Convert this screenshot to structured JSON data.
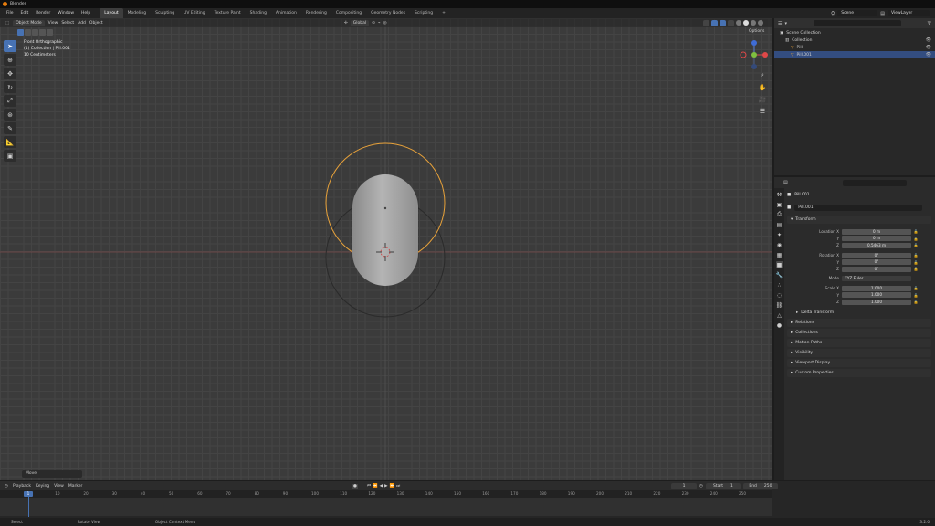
{
  "app": {
    "title": "Blender"
  },
  "menus": [
    "File",
    "Edit",
    "Render",
    "Window",
    "Help"
  ],
  "workspaces": [
    {
      "label": "Layout",
      "active": true
    },
    {
      "label": "Modeling",
      "active": false
    },
    {
      "label": "Sculpting",
      "active": false
    },
    {
      "label": "UV Editing",
      "active": false
    },
    {
      "label": "Texture Paint",
      "active": false
    },
    {
      "label": "Shading",
      "active": false
    },
    {
      "label": "Animation",
      "active": false
    },
    {
      "label": "Rendering",
      "active": false
    },
    {
      "label": "Compositing",
      "active": false
    },
    {
      "label": "Geometry Nodes",
      "active": false
    },
    {
      "label": "Scripting",
      "active": false
    },
    {
      "label": "+",
      "active": false
    }
  ],
  "scene": {
    "name": "Scene",
    "view_layer": "ViewLayer"
  },
  "viewport": {
    "mode": "Object Mode",
    "menu": [
      "View",
      "Select",
      "Add",
      "Object"
    ],
    "transform_orientation": "Global",
    "options_label": "Options",
    "overlay_lines": [
      "Front Orthographic",
      "(1) Collection | Pill.001",
      "10 Centimeters"
    ],
    "redo_label": "Move"
  },
  "toolbar": [
    "select",
    "cursor",
    "move",
    "rotate",
    "scale",
    "transform",
    "annotate",
    "measure",
    "add-cube"
  ],
  "outliner": {
    "rows": [
      {
        "label": "Scene Collection",
        "indent": 0,
        "selected": false
      },
      {
        "label": "Collection",
        "indent": 1,
        "selected": false
      },
      {
        "label": "Pill",
        "indent": 2,
        "selected": false
      },
      {
        "label": "Pill.001",
        "indent": 2,
        "selected": true
      }
    ]
  },
  "properties": {
    "object_name": "Pill.001",
    "object_field": "Pill.001",
    "transform_label": "Transform",
    "location_label": "Location X",
    "rotation_label": "Rotation X",
    "scale_label": "Scale X",
    "mode_label": "Mode",
    "mode_value": "XYZ Euler",
    "axis_y": "Y",
    "axis_z": "Z",
    "location": [
      "0 m",
      "0 m",
      "0.5463 m"
    ],
    "rotation": [
      "0°",
      "0°",
      "0°"
    ],
    "scale": [
      "1.000",
      "1.000",
      "1.000"
    ],
    "sections": [
      "Delta Transform",
      "Relations",
      "Collections",
      "Motion Paths",
      "Visibility",
      "Viewport Display",
      "Custom Properties"
    ]
  },
  "timeline": {
    "menu": [
      "Playback",
      "Keying",
      "View",
      "Marker"
    ],
    "current_frame": "1",
    "start_label": "Start",
    "start": "1",
    "end_label": "End",
    "end": "250",
    "frame_ticks": [
      "0",
      "10",
      "20",
      "30",
      "40",
      "50",
      "60",
      "70",
      "80",
      "90",
      "100",
      "110",
      "120",
      "130",
      "140",
      "150",
      "160",
      "170",
      "180",
      "190",
      "200",
      "210",
      "220",
      "230",
      "240",
      "250"
    ]
  },
  "statusbar": [
    "Select",
    "Rotate View",
    "Object Context Menu"
  ],
  "version": "3.2.0",
  "colors": {
    "accent": "#4772b3",
    "selection_orange": "#e8a23a",
    "viewport_bg": "#3b3b3b"
  }
}
